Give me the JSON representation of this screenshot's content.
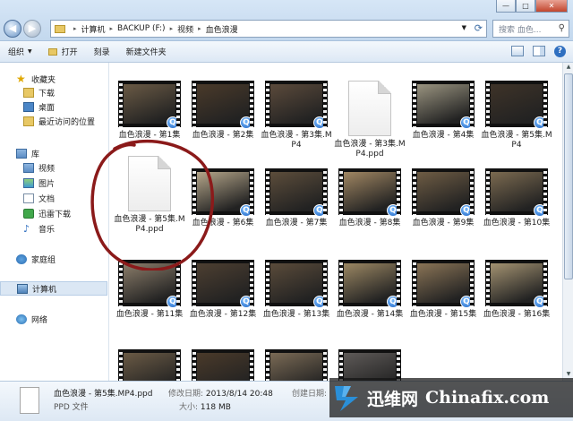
{
  "address": {
    "crumbs": [
      "计算机",
      "BACKUP (F:)",
      "视频",
      "血色浪漫"
    ]
  },
  "search": {
    "placeholder": "搜索 血色..."
  },
  "toolbar": {
    "organize": "组织",
    "open": "打开",
    "burn": "刻录",
    "new_folder": "新建文件夹"
  },
  "sidebar": {
    "favorites": "收藏夹",
    "downloads": "下载",
    "desktop": "桌面",
    "recent": "最近访问的位置",
    "libraries": "库",
    "videos": "视频",
    "pictures": "图片",
    "documents": "文档",
    "xunlei": "迅雷下载",
    "music": "音乐",
    "homegroup": "家庭组",
    "computer": "计算机",
    "network": "网络"
  },
  "files": [
    {
      "label": "血色浪漫 - 第1集",
      "kind": "video",
      "scene": "#6a5a45"
    },
    {
      "label": "血色浪漫 - 第2集",
      "kind": "video",
      "scene": "#4a3a2a"
    },
    {
      "label": "血色浪漫 - 第3集.MP4",
      "kind": "video",
      "scene": "#5b4a3b"
    },
    {
      "label": "血色浪漫 - 第3集.MP4.ppd",
      "kind": "doc"
    },
    {
      "label": "血色浪漫 - 第4集",
      "kind": "video",
      "scene": "#9a9480"
    },
    {
      "label": "血色浪漫 - 第5集.MP4",
      "kind": "video",
      "scene": "#3e3328"
    },
    {
      "label": "血色浪漫 - 第5集.MP4.ppd",
      "kind": "doc"
    },
    {
      "label": "血色浪漫 - 第6集",
      "kind": "video",
      "scene": "#b5a68a"
    },
    {
      "label": "血色浪漫 - 第7集",
      "kind": "video",
      "scene": "#5c4d3b"
    },
    {
      "label": "血色浪漫 - 第8集",
      "kind": "video",
      "scene": "#a08662"
    },
    {
      "label": "血色浪漫 - 第9集",
      "kind": "video",
      "scene": "#6e5c44"
    },
    {
      "label": "血色浪漫 - 第10集",
      "kind": "video",
      "scene": "#7b6a50"
    },
    {
      "label": "血色浪漫 - 第11集",
      "kind": "video",
      "scene": "#8b7d6a"
    },
    {
      "label": "血色浪漫 - 第12集",
      "kind": "video",
      "scene": "#4d3f31"
    },
    {
      "label": "血色浪漫 - 第13集",
      "kind": "video",
      "scene": "#5a4b3a"
    },
    {
      "label": "血色浪漫 - 第14集",
      "kind": "video",
      "scene": "#9b8763"
    },
    {
      "label": "血色浪漫 - 第15集",
      "kind": "video",
      "scene": "#8a7456"
    },
    {
      "label": "血色浪漫 - 第16集",
      "kind": "video",
      "scene": "#a39271"
    },
    {
      "label": "",
      "kind": "video",
      "scene": "#6a5a45"
    },
    {
      "label": "",
      "kind": "video",
      "scene": "#4a3a2a"
    },
    {
      "label": "",
      "kind": "video",
      "scene": "#7a6a55"
    },
    {
      "label": "",
      "kind": "video",
      "scene": "#5e5a58"
    }
  ],
  "details": {
    "name": "血色浪漫 - 第5集.MP4.ppd",
    "type": "PPD 文件",
    "modified_label": "修改日期:",
    "modified": "2013/8/14 20:48",
    "size_label": "大小:",
    "size": "118 MB",
    "created_label": "创建日期:"
  },
  "watermark": {
    "cn": "迅维网",
    "en": "Chinafix.com"
  },
  "window": {
    "min": "—",
    "max": "□",
    "close": "✕"
  },
  "colors": {
    "annotation": "#8b1a1a",
    "badge": "#1d63c4"
  }
}
